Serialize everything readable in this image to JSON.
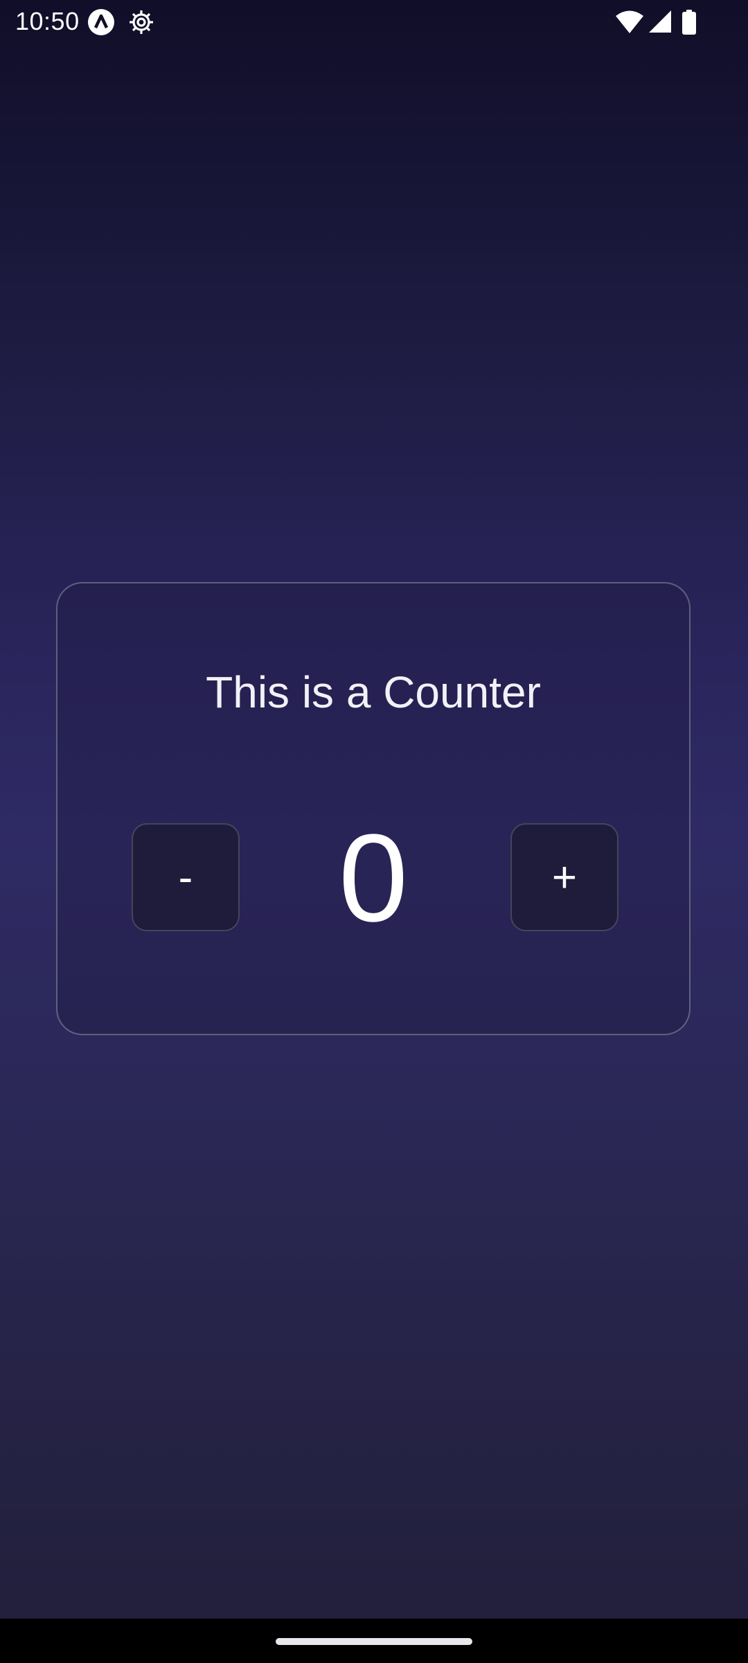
{
  "status_bar": {
    "time": "10:50",
    "icons": [
      "a-logo-icon",
      "gear-icon",
      "wifi-icon",
      "signal-icon",
      "battery-icon"
    ]
  },
  "counter": {
    "title": "This is a Counter",
    "value": "0",
    "decrement_label": "-",
    "increment_label": "+"
  },
  "colors": {
    "background_top": "#100e28",
    "background_mid": "#2f2a64",
    "background_bottom": "#22203c",
    "button_bg": "#1e1c3a",
    "text": "#ffffff"
  }
}
